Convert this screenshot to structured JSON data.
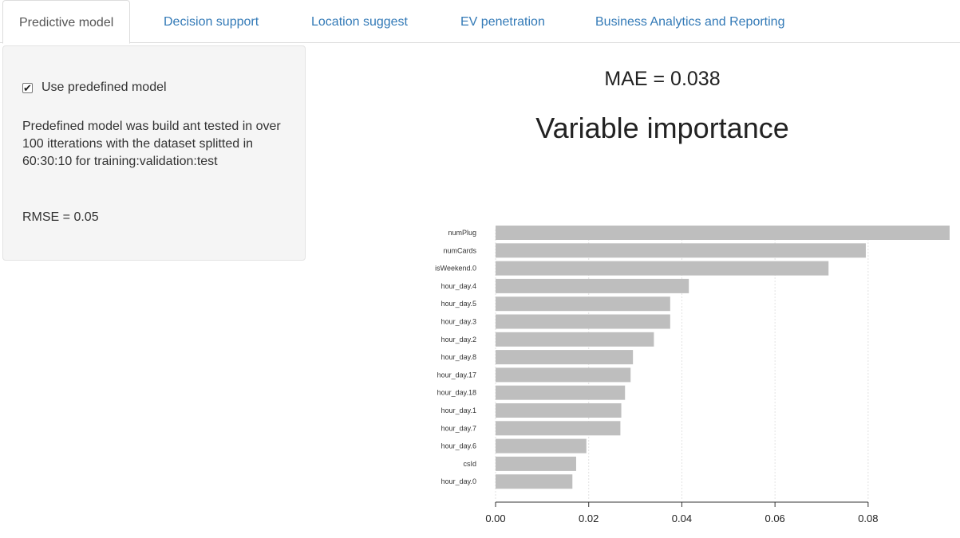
{
  "tabs": [
    {
      "label": "Predictive model",
      "active": true
    },
    {
      "label": "Decision support",
      "active": false
    },
    {
      "label": "Location suggest",
      "active": false
    },
    {
      "label": "EV penetration",
      "active": false
    },
    {
      "label": "Business Analytics and Reporting",
      "active": false
    }
  ],
  "sidebar": {
    "checkbox_label": "Use predefined model",
    "checkbox_checked": true,
    "description": "Predefined model was build ant tested in over 100 itterations with the dataset splitted in 60:30:10 for training:validation:test",
    "rmse": "RMSE = 0.05"
  },
  "main": {
    "mae": "MAE = 0.038"
  },
  "chart_data": {
    "type": "bar",
    "orientation": "horizontal",
    "title": "Variable importance",
    "categories": [
      "numPlug",
      "numCards",
      "isWeekend.0",
      "hour_day.4",
      "hour_day.5",
      "hour_day.3",
      "hour_day.2",
      "hour_day.8",
      "hour_day.17",
      "hour_day.18",
      "hour_day.1",
      "hour_day.7",
      "hour_day.6",
      "csId",
      "hour_day.0"
    ],
    "values": [
      0.0975,
      0.0795,
      0.0715,
      0.0415,
      0.0375,
      0.0375,
      0.034,
      0.0295,
      0.029,
      0.0278,
      0.027,
      0.0268,
      0.0195,
      0.0173,
      0.0165
    ],
    "xticks": [
      "0.00",
      "0.02",
      "0.04",
      "0.06",
      "0.08"
    ],
    "xlim": [
      0,
      0.0975
    ],
    "xlabel": "",
    "ylabel": "",
    "grid": true,
    "bar_color": "#bebebe"
  }
}
